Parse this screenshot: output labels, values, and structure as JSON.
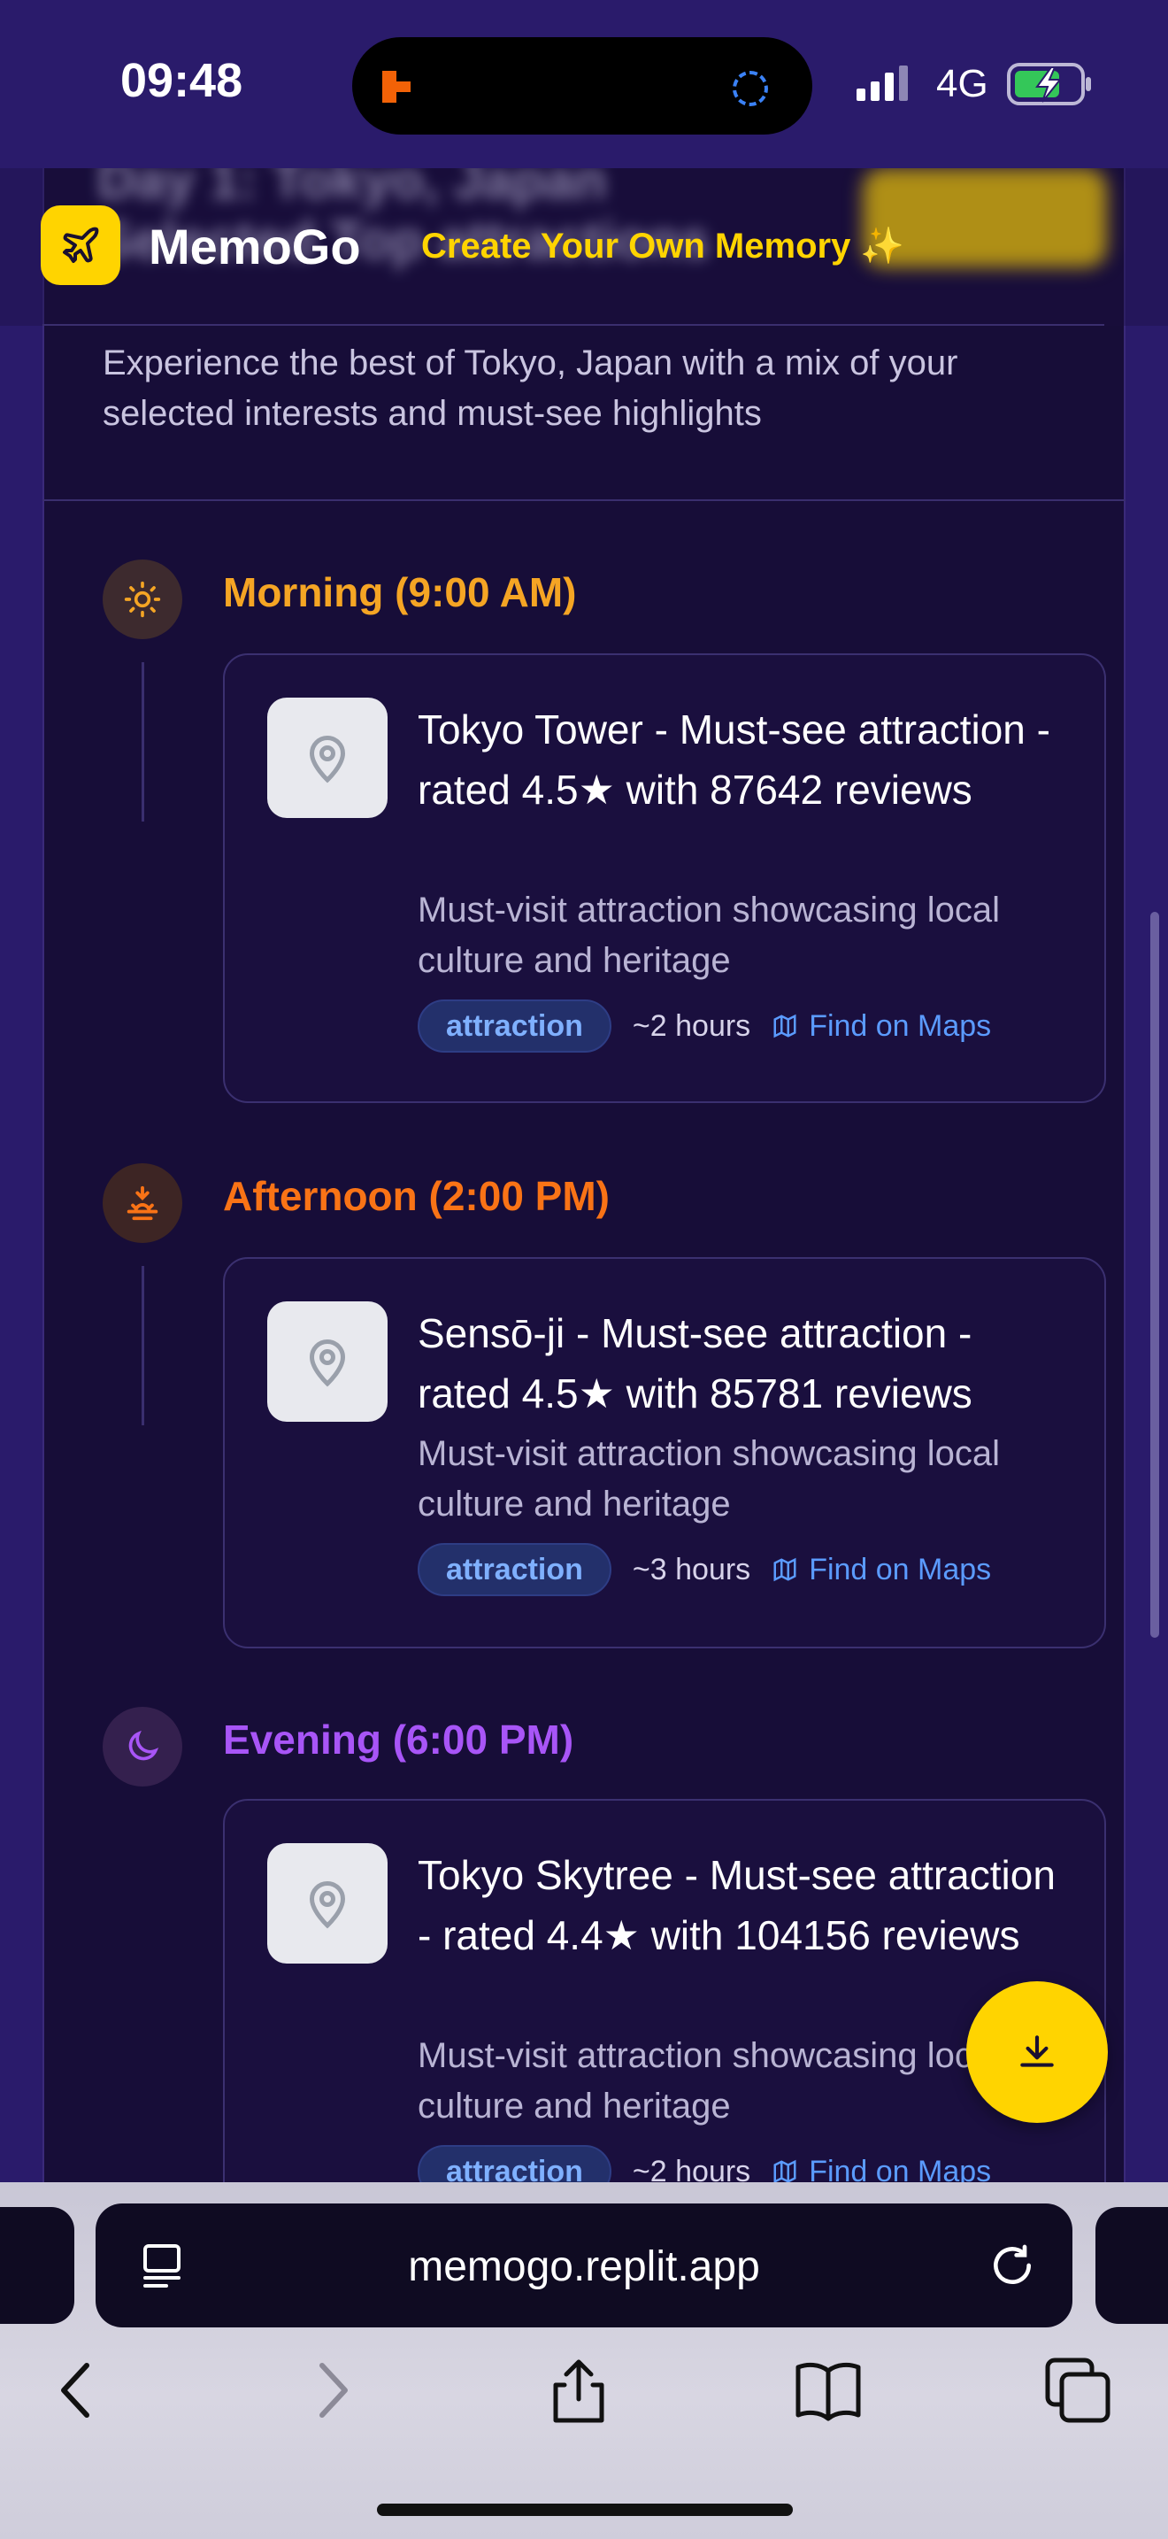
{
  "status": {
    "time": "09:48",
    "network": "4G"
  },
  "header": {
    "brand": "MemoGo",
    "create_link": "Create Your Own Memory ✨",
    "blurred_title": "Day 1: Tokyo, Japan Selected Top attractions"
  },
  "intro": "Experience the best of Tokyo, Japan with a mix of your selected interests and must-see highlights",
  "slots": [
    {
      "title": "Morning (9:00 AM)",
      "color": "#f5a524",
      "item": {
        "title": "Tokyo Tower - Must-see attraction - rated 4.5★ with 87642 reviews",
        "description": "Must-visit attraction showcasing local culture and heritage",
        "tag": "attraction",
        "duration": "~2 hours",
        "maps_label": "Find on Maps"
      }
    },
    {
      "title": "Afternoon (2:00 PM)",
      "color": "#f97316",
      "item": {
        "title": "Sensō-ji - Must-see attraction - rated 4.5★ with 85781 reviews",
        "description": "Must-visit attraction showcasing local culture and heritage",
        "tag": "attraction",
        "duration": "~3 hours",
        "maps_label": "Find on Maps"
      }
    },
    {
      "title": "Evening (6:00 PM)",
      "color": "#a855f7",
      "item": {
        "title": "Tokyo Skytree - Must-see attraction - rated 4.4★ with 104156 reviews",
        "description": "Must-visit attraction showcasing local culture and heritage",
        "tag": "attraction",
        "duration": "~2 hours",
        "maps_label": "Find on Maps"
      }
    }
  ],
  "browser": {
    "url": "memogo.replit.app"
  },
  "colors": {
    "accent": "#ffd400",
    "background": "#170d38",
    "link": "#5b9bff"
  }
}
